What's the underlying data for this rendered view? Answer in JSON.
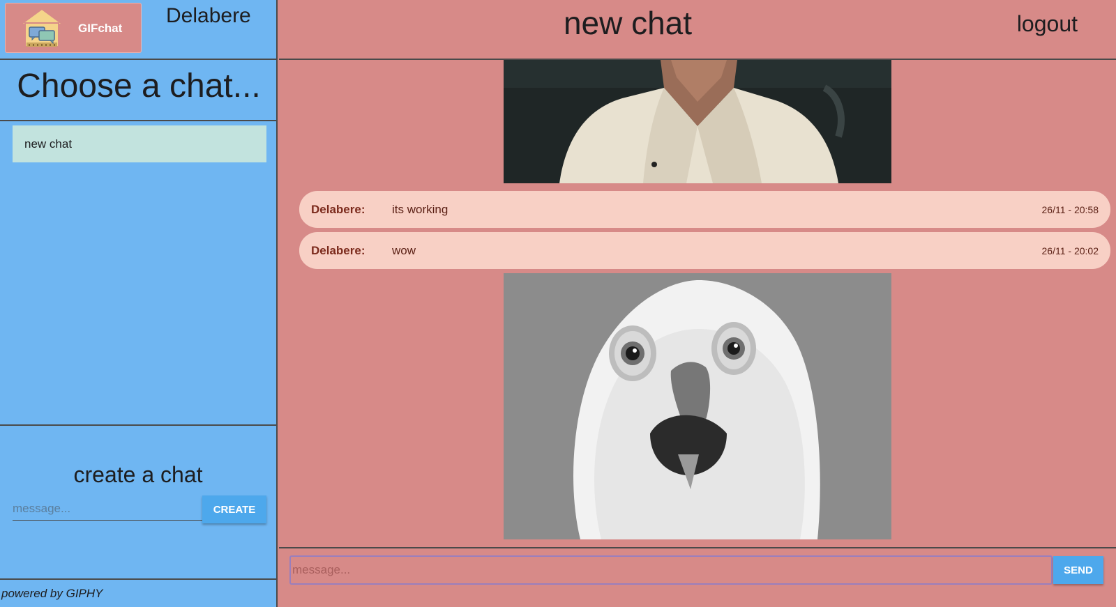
{
  "sidebar": {
    "logo_text": "GIFchat",
    "username": "Delabere",
    "choose_title": "Choose a chat...",
    "chat_list": [
      {
        "label": "new chat"
      }
    ],
    "create": {
      "title": "create a chat",
      "placeholder": "message...",
      "button_label": "CREATE"
    },
    "footer": "powered by GIPHY"
  },
  "header": {
    "chat_title": "new chat",
    "logout_label": "logout"
  },
  "messages": [
    {
      "type": "gif",
      "depicts": "person-in-white-shirt-gif"
    },
    {
      "type": "text",
      "sender": "Delabere:",
      "text": "its working",
      "time": "26/11 - 20:58"
    },
    {
      "type": "text",
      "sender": "Delabere:",
      "text": "wow",
      "time": "26/11 - 20:02"
    },
    {
      "type": "gif",
      "depicts": "surprised-owl-gif"
    }
  ],
  "composer": {
    "placeholder": "message...",
    "send_label": "SEND"
  },
  "colors": {
    "sidebar_bg": "#6fb6f2",
    "main_bg": "#d78a88",
    "chat_item_bg": "#c2e3de",
    "bubble_bg": "#f8d0c5",
    "button_bg": "#4da8ec",
    "sender_text": "#7b2a1c"
  }
}
